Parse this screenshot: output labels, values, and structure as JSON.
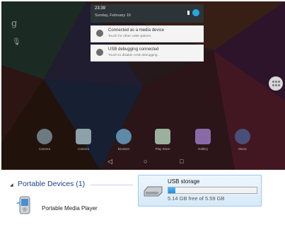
{
  "notification_shade": {
    "time": "23:39",
    "date": "Sunday, February 16",
    "cards": [
      {
        "title": "Connected as a media device",
        "subtitle": "Touch for other USB options.",
        "icon": "usb-icon"
      },
      {
        "title": "USB debugging connected",
        "subtitle": "Touch to disable USB debugging.",
        "icon": "android-debug-icon"
      }
    ]
  },
  "side_icons": {
    "top": "g",
    "bottom": "mic-icon"
  },
  "dock": [
    {
      "label": "Camera",
      "icon": "camera-icon",
      "color": "#6d7a82"
    },
    {
      "label": "Camera",
      "icon": "camera-icon",
      "color": "#8ea0aa"
    },
    {
      "label": "Browser",
      "icon": "globe-icon",
      "color": "#5c8aa8"
    },
    {
      "label": "Play Store",
      "icon": "play-store-icon",
      "color": "#9bb09e"
    },
    {
      "label": "Gallery",
      "icon": "gallery-icon",
      "color": "#8a6aa6"
    },
    {
      "label": "Music",
      "icon": "music-icon",
      "color": "#4a4f7a"
    }
  ],
  "nav_bar": {
    "back": "◁",
    "home": "○",
    "recents": "□"
  },
  "windows_explorer": {
    "group_title": "Portable Devices (1)",
    "device_label": "Portable Media Player",
    "storage": {
      "name": "USB storage",
      "free_text": "5.14 GB free of 5.59 GB",
      "used_fraction": 0.08
    }
  }
}
